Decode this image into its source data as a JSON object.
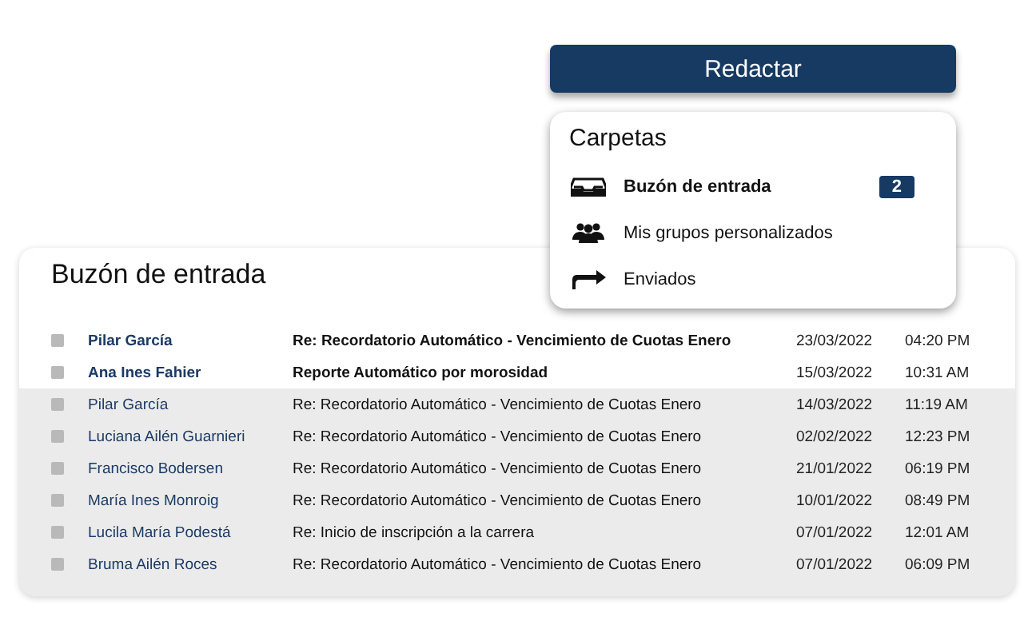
{
  "compose_button": {
    "label": "Redactar"
  },
  "folders": {
    "title": "Carpetas",
    "items": [
      {
        "kind": "inbox",
        "label": "Buzón de entrada",
        "selected": true,
        "badge": "2"
      },
      {
        "kind": "groups",
        "label": "Mis grupos personalizados",
        "selected": false
      },
      {
        "kind": "sent",
        "label": "Enviados",
        "selected": false
      }
    ]
  },
  "inbox": {
    "title": "Buzón de entrada",
    "rows": [
      {
        "sender": "Pilar García",
        "subject": "Re: Recordatorio Automático - Vencimiento de Cuotas Enero",
        "date": "23/03/2022",
        "time": "04:20 PM",
        "unread": true,
        "checked": false
      },
      {
        "sender": "Ana Ines Fahier",
        "subject": "Reporte Automático por morosidad",
        "date": "15/03/2022",
        "time": "10:31 AM",
        "unread": true,
        "checked": false
      },
      {
        "sender": "Pilar García",
        "subject": "Re: Recordatorio Automático - Vencimiento de Cuotas Enero",
        "date": "14/03/2022",
        "time": "11:19 AM",
        "unread": false,
        "checked": false
      },
      {
        "sender": "Luciana Ailén Guarnieri",
        "subject": "Re: Recordatorio Automático - Vencimiento de Cuotas Enero",
        "date": "02/02/2022",
        "time": "12:23 PM",
        "unread": false,
        "checked": false
      },
      {
        "sender": "Francisco Bodersen",
        "subject": "Re: Recordatorio Automático - Vencimiento de Cuotas Enero",
        "date": "21/01/2022",
        "time": "06:19 PM",
        "unread": false,
        "checked": false
      },
      {
        "sender": "María Ines Monroig",
        "subject": "Re: Recordatorio Automático - Vencimiento de Cuotas Enero",
        "date": "10/01/2022",
        "time": "08:49 PM",
        "unread": false,
        "checked": false
      },
      {
        "sender": "Lucila María Podestá",
        "subject": "Re: Inicio de inscripción a la carrera",
        "date": "07/01/2022",
        "time": "12:01 AM",
        "unread": false,
        "checked": false
      },
      {
        "sender": "Bruma Ailén Roces",
        "subject": "Re: Recordatorio Automático - Vencimiento de Cuotas Enero",
        "date": "07/01/2022",
        "time": "06:09 PM",
        "unread": false,
        "checked": false
      }
    ]
  }
}
